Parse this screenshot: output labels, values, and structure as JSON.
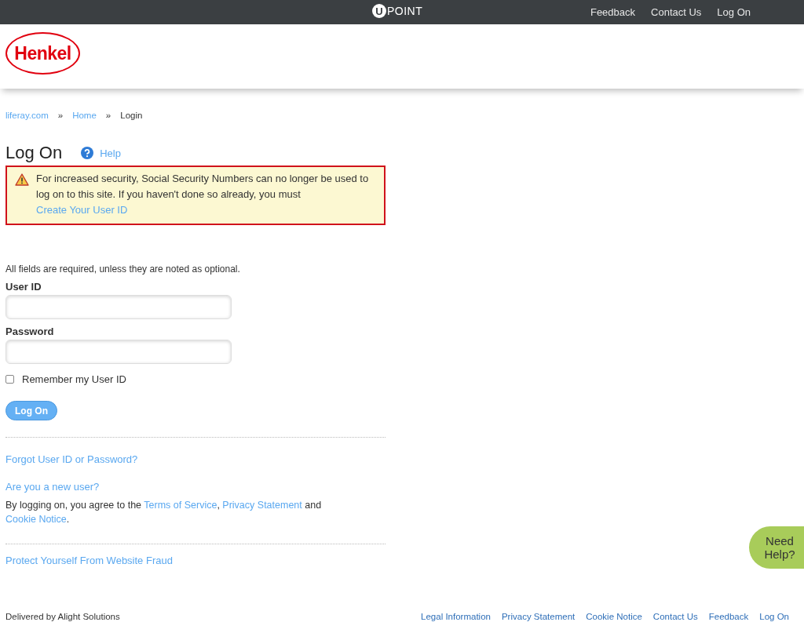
{
  "top_bar": {
    "logo": {
      "badge": "U",
      "text": "POINT"
    },
    "links": [
      "Feedback",
      "Contact Us",
      "Log On"
    ]
  },
  "brand": {
    "logo_text": "Henkel"
  },
  "breadcrumb": [
    {
      "label": "liferay.com",
      "kind": "link"
    },
    {
      "label": "»",
      "kind": "separator"
    },
    {
      "label": "Home",
      "kind": "link"
    },
    {
      "label": "»",
      "kind": "separator"
    },
    {
      "label": "Login",
      "kind": "current"
    }
  ],
  "page_title": "Log On",
  "help_link": "Help",
  "warning": {
    "parts": [
      {
        "kind": "text",
        "text": "For increased security, Social Security Numbers can no longer be used to log on to this site. If you haven't done so already, you must "
      },
      {
        "kind": "link",
        "text": "Create Your User ID"
      }
    ]
  },
  "required_note": "All fields are required, unless they are noted as optional.",
  "fields": [
    {
      "label": "User ID"
    },
    {
      "label": "Password"
    }
  ],
  "remember": {
    "label": "Remember my User ID",
    "checked": false
  },
  "submit_button": "Log On",
  "forgot_link": "Forgot User ID or Password?",
  "new_user_link": "Are you a new user?",
  "agreement": [
    {
      "kind": "text",
      "text": "By logging on, you agree to the "
    },
    {
      "kind": "link",
      "text": "Terms of Service"
    },
    {
      "kind": "text",
      "text": ", "
    },
    {
      "kind": "link",
      "text": "Privacy Statement"
    },
    {
      "kind": "text",
      "text": " and "
    },
    {
      "kind": "link",
      "text": "Cookie Notice"
    },
    {
      "kind": "text",
      "text": "."
    }
  ],
  "fraud_link": "Protect Yourself From Website Fraud",
  "footer": {
    "delivered_by": "Delivered by Alight Solutions",
    "links": [
      "Legal Information",
      "Privacy Statement",
      "Cookie Notice",
      "Contact Us",
      "Feedback",
      "Log On"
    ]
  },
  "help_bubble": "Need Help?"
}
